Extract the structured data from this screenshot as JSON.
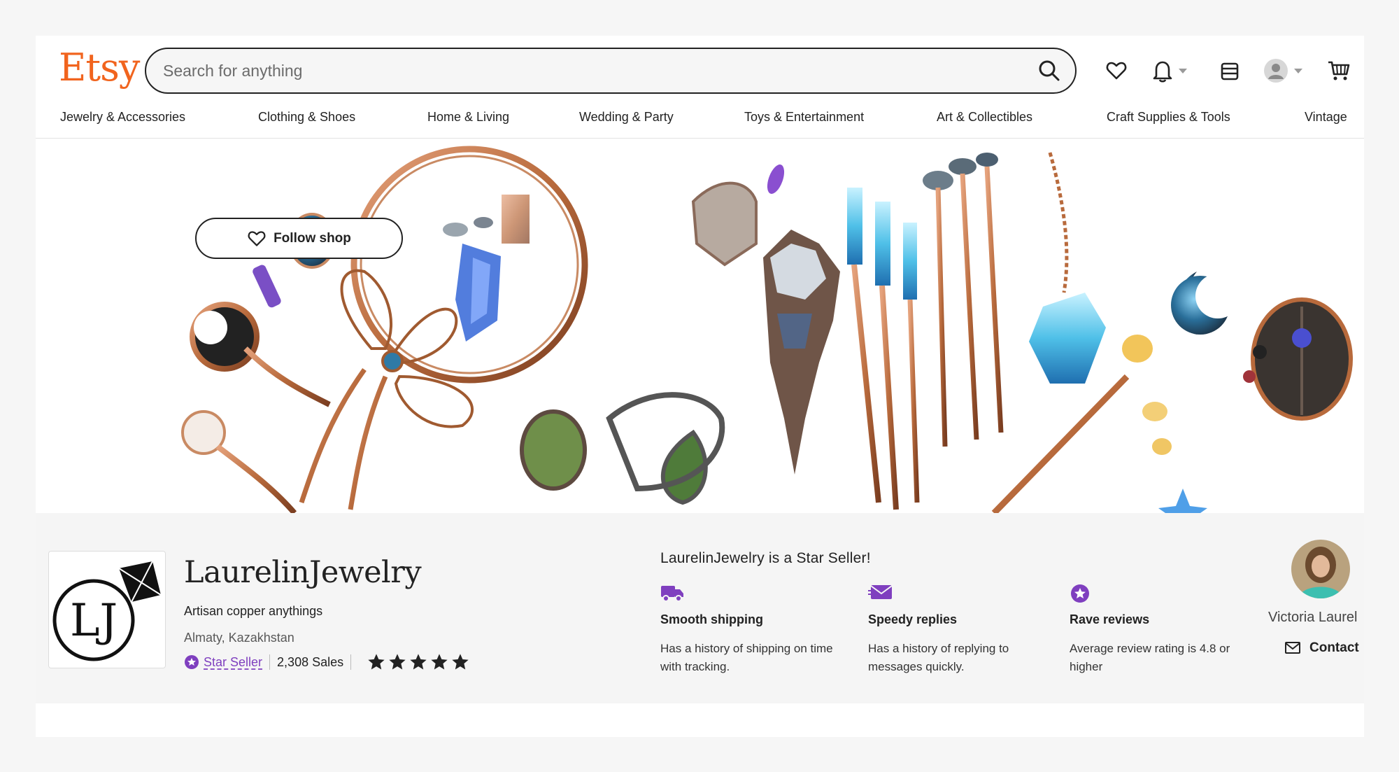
{
  "header": {
    "logo": "Etsy",
    "search": {
      "placeholder": "Search for anything"
    },
    "icons": [
      "heart-icon",
      "bell-icon",
      "shop-manager-icon",
      "account-avatar-icon",
      "cart-icon"
    ]
  },
  "categories": [
    "Jewelry & Accessories",
    "Clothing & Shoes",
    "Home & Living",
    "Wedding & Party",
    "Toys & Entertainment",
    "Art & Collectibles",
    "Craft Supplies & Tools",
    "Vintage"
  ],
  "shop": {
    "name": "LaurelinJewelry",
    "tagline": "Artisan copper anythings",
    "location": "Almaty, Kazakhstan",
    "star_seller": "Star Seller",
    "sales": "2,308 Sales",
    "rating": 5,
    "follow": "Follow shop"
  },
  "star_seller_panel": {
    "heading": "LaurelinJewelry is a Star Seller!",
    "perks": [
      {
        "title": "Smooth shipping",
        "desc": "Has a history of shipping on time with tracking."
      },
      {
        "title": "Speedy replies",
        "desc": "Has a history of replying to messages quickly."
      },
      {
        "title": "Rave reviews",
        "desc": "Average review rating is 4.8 or higher"
      }
    ]
  },
  "owner": {
    "name": "Victoria Laurel",
    "contact": "Contact"
  },
  "colors": {
    "brand": "#f1641e",
    "star_seller": "#7f3fbf"
  }
}
